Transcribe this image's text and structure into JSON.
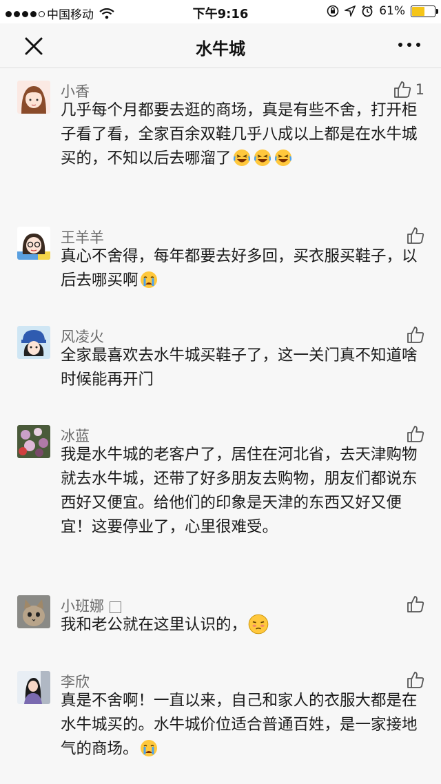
{
  "status_bar": {
    "carrier": "中国移动",
    "time": "下午9:16",
    "battery": "61%",
    "battery_level": 0.61
  },
  "nav": {
    "title": "水牛城"
  },
  "comments": [
    {
      "name": "小香",
      "likes": "1",
      "text": "几乎每个月都要去逛的商场，真是有些不舍，打开柜子看了看，全家百余双鞋几乎八成以上都是在水牛城买的，不知以后去哪溜了",
      "emoji": [
        "laugh-cry-icon",
        "laugh-cry-icon",
        "laugh-cry-icon"
      ]
    },
    {
      "name": "王羊羊",
      "likes": "",
      "text": "真心不舍得，每年都要去好多回，买衣服买鞋子，以后去哪买啊",
      "emoji": [
        "crying-icon"
      ]
    },
    {
      "name": "风凌火",
      "likes": "",
      "text": "全家最喜欢去水牛城买鞋子了，这一关门真不知道啥时候能再开门",
      "emoji": []
    },
    {
      "name": "冰蓝",
      "likes": "",
      "text": "我是水牛城的老客户了，居住在河北省，去天津购物就去水牛城，还带了好多朋友去购物，朋友们都说东西好又便宜。给他们的印象是天津的东西又好又便宜！这要停业了，心里很难受。",
      "emoji": []
    },
    {
      "name": "小班娜",
      "likes": "",
      "text": "我和老公就在这里认识的，",
      "emoji": [
        "shy-icon"
      ]
    },
    {
      "name": "李欣",
      "likes": "",
      "text": "真是不舍啊！一直以来，自己和家人的衣服大都是在水牛城买的。水牛城价位适合普通百姓，是一家接地气的商场。",
      "emoji": [
        "crying-icon"
      ]
    }
  ]
}
